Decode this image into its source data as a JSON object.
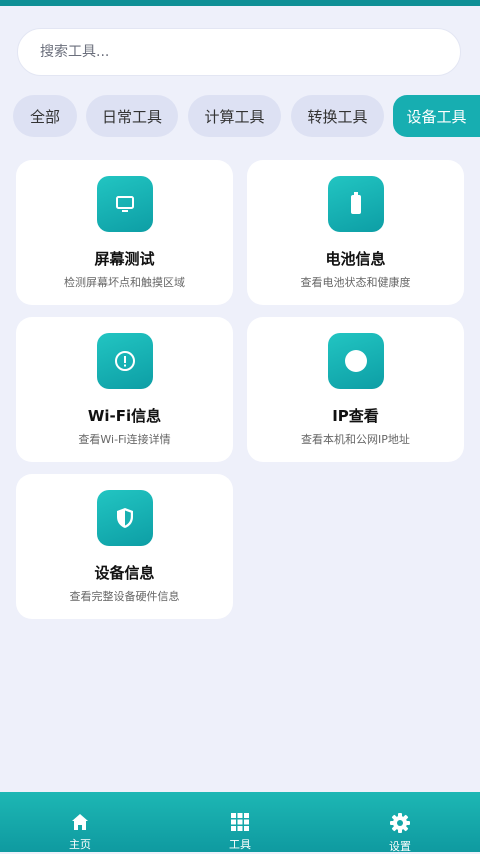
{
  "search": {
    "placeholder": "搜索工具..."
  },
  "categories": [
    {
      "label": "全部"
    },
    {
      "label": "日常工具"
    },
    {
      "label": "计算工具"
    },
    {
      "label": "转换工具"
    },
    {
      "label": "设备工具"
    }
  ],
  "active_category": "设备工具",
  "tools": [
    {
      "title": "屏幕测试",
      "desc": "检测屏幕坏点和触摸区域",
      "icon": "monitor-icon"
    },
    {
      "title": "电池信息",
      "desc": "查看电池状态和健康度",
      "icon": "battery-icon"
    },
    {
      "title": "Wi-Fi信息",
      "desc": "查看Wi-Fi连接详情",
      "icon": "alert-circle-icon"
    },
    {
      "title": "IP查看",
      "desc": "查看本机和公网IP地址",
      "icon": "circle-dot-icon"
    },
    {
      "title": "设备信息",
      "desc": "查看完整设备硬件信息",
      "icon": "shield-icon"
    }
  ],
  "nav": [
    {
      "label": "主页",
      "icon": "home-icon"
    },
    {
      "label": "工具",
      "icon": "grid-icon"
    },
    {
      "label": "设置",
      "icon": "gear-icon"
    }
  ],
  "colors": {
    "accent": "#17aeb1",
    "background": "#eef0fa",
    "chip": "#dde1f3"
  }
}
